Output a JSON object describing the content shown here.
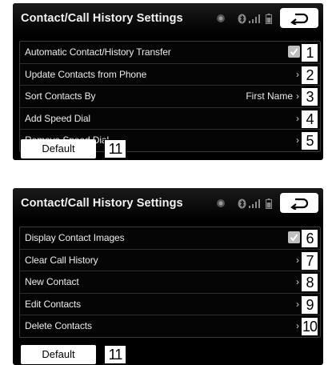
{
  "screens": [
    {
      "title": "Contact/Call History Settings",
      "rows": [
        {
          "label": "Automatic Contact/History Transfer",
          "control": "check",
          "callout": "1"
        },
        {
          "label": "Update Contacts from Phone",
          "control": "chevron",
          "chevron": "›",
          "callout": "2"
        },
        {
          "label": "Sort Contacts By",
          "control": "chevron",
          "value": "First Name",
          "chevron": "›",
          "callout": "3"
        },
        {
          "label": "Add Speed Dial",
          "control": "chevron",
          "chevron": "›",
          "callout": "4"
        },
        {
          "label": "Remove Speed Dial",
          "control": "chevron",
          "chevron": "›",
          "callout": "5"
        }
      ],
      "default_label": "Default",
      "default_callout": "11"
    },
    {
      "title": "Contact/Call History Settings",
      "rows": [
        {
          "label": "Display Contact Images",
          "control": "check",
          "callout": "6"
        },
        {
          "label": "Clear Call History",
          "control": "chevron",
          "chevron": "›",
          "callout": "7"
        },
        {
          "label": "New Contact",
          "control": "chevron",
          "chevron": "›",
          "callout": "8"
        },
        {
          "label": "Edit Contacts",
          "control": "chevron",
          "chevron": "›",
          "callout": "9"
        },
        {
          "label": "Delete Contacts",
          "control": "chevron",
          "chevron": "›",
          "callout": "10"
        }
      ],
      "default_label": "Default",
      "default_callout": "11"
    }
  ],
  "icons": {
    "status": [
      "settings-dot-icon",
      "bluetooth-icon",
      "signal-bars-icon",
      "battery-icon"
    ],
    "back": "back-arrow-icon",
    "check": "checkmark-icon"
  },
  "colors": {
    "screen_bg": "#000000",
    "text": "#ececec",
    "check_bg": "#bfbfbf",
    "button_bg": "#ffffff"
  }
}
